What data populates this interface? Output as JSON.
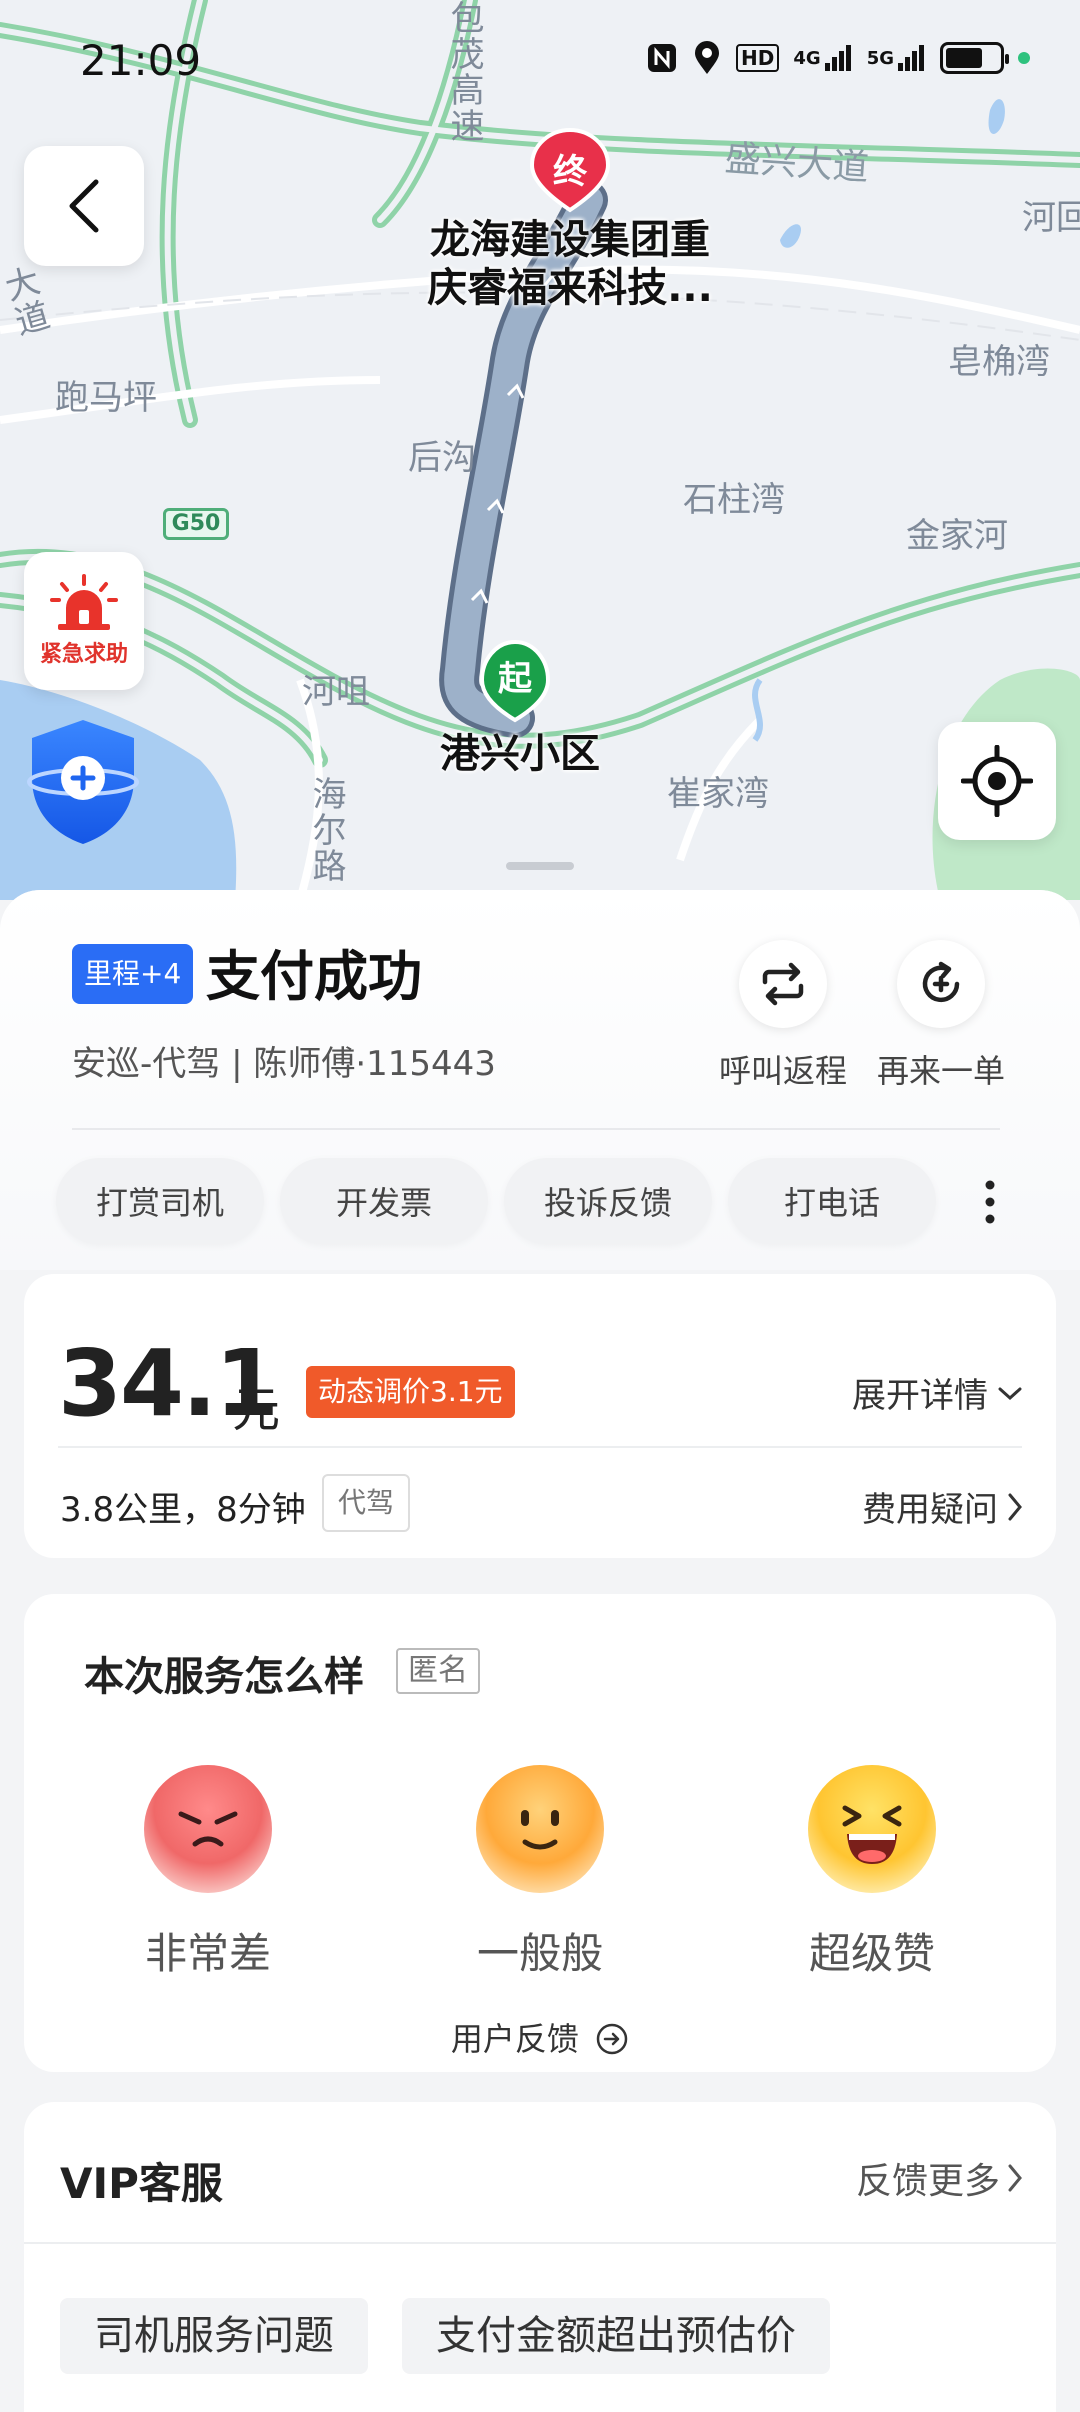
{
  "status_bar": {
    "time": "21:09",
    "net1": "HD",
    "net2": "4G",
    "net3": "5G"
  },
  "map": {
    "places": {
      "baomao": "包茂高速",
      "shengxing": "盛兴大道",
      "he_top": "河回",
      "paomaping": "跑马坪",
      "zaojiaowan": "皂桷湾",
      "hougou": "后沟",
      "shizhuwan": "石柱湾",
      "jinjiahe": "金家河",
      "hezui": "河咀",
      "cuijiawan": "崔家湾",
      "haierlu": "海尔路",
      "da": "大道",
      "g50": "G50"
    },
    "start_marker": "起",
    "end_marker": "终",
    "start_label": "港兴小区",
    "end_label_line1": "龙海建设集团重",
    "end_label_line2": "庆睿福来科技..."
  },
  "buttons": {
    "sos": "紧急求助"
  },
  "order": {
    "mileage_badge": "里程+4",
    "status": "支付成功",
    "driver_info": "安巡-代驾 | 陈师傅·115443",
    "return_trip": "呼叫返程",
    "reorder": "再来一单",
    "pills": [
      "打赏司机",
      "开发票",
      "投诉反馈",
      "打电话"
    ]
  },
  "price": {
    "amount": "34.1",
    "unit": "元",
    "dynamic": "动态调价3.1元",
    "expand": "展开详情",
    "distance": "3.8公里，8分钟",
    "service_tag": "代驾",
    "fee_question": "费用疑问"
  },
  "rating": {
    "title": "本次服务怎么样",
    "anonymous": "匿名",
    "options": [
      "非常差",
      "一般般",
      "超级赞"
    ],
    "feedback": "用户反馈"
  },
  "vip": {
    "title": "VIP客服",
    "more": "反馈更多",
    "questions": [
      "司机服务问题",
      "支付金额超出预估价"
    ]
  },
  "colors": {
    "accent": "#2a6df5",
    "dynamic_price": "#f05a2a",
    "route": "#7e93b0",
    "start": "#1aa04a",
    "end": "#e8304a"
  }
}
